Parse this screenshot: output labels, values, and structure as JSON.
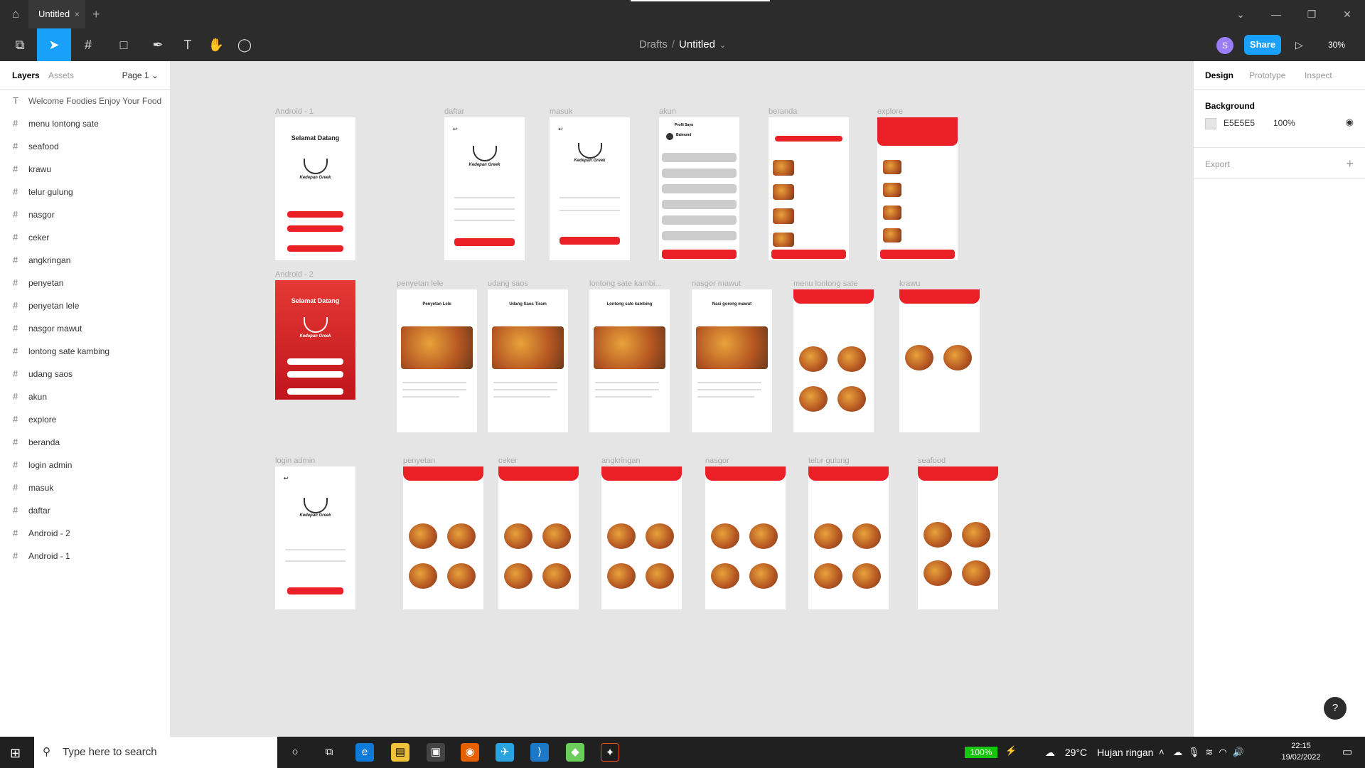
{
  "titlebar": {
    "tab_title": "Untitled",
    "close": "×",
    "new_tab": "+"
  },
  "toolbar": {
    "breadcrumb_drafts": "Drafts",
    "breadcrumb_sep": "/",
    "file_name": "Untitled",
    "avatar_letter": "S",
    "share_label": "Share",
    "zoom": "30%"
  },
  "left_panel": {
    "tab_layers": "Layers",
    "tab_assets": "Assets",
    "page_label": "Page 1",
    "layers": [
      {
        "label": "Welcome Foodies Enjoy Your Food",
        "type": "text"
      },
      {
        "label": "menu lontong sate",
        "type": "frame"
      },
      {
        "label": "seafood",
        "type": "frame"
      },
      {
        "label": "krawu",
        "type": "frame"
      },
      {
        "label": "telur gulung",
        "type": "frame"
      },
      {
        "label": "nasgor",
        "type": "frame"
      },
      {
        "label": "ceker",
        "type": "frame"
      },
      {
        "label": "angkringan",
        "type": "frame"
      },
      {
        "label": "penyetan",
        "type": "frame"
      },
      {
        "label": "penyetan lele",
        "type": "frame"
      },
      {
        "label": "nasgor mawut",
        "type": "frame"
      },
      {
        "label": "lontong sate kambing",
        "type": "frame"
      },
      {
        "label": "udang saos",
        "type": "frame"
      },
      {
        "label": "akun",
        "type": "frame"
      },
      {
        "label": "explore",
        "type": "frame"
      },
      {
        "label": "beranda",
        "type": "frame"
      },
      {
        "label": "login admin",
        "type": "frame"
      },
      {
        "label": "masuk",
        "type": "frame"
      },
      {
        "label": "daftar",
        "type": "frame"
      },
      {
        "label": "Android - 2",
        "type": "frame"
      },
      {
        "label": "Android - 1",
        "type": "frame"
      }
    ]
  },
  "right_panel": {
    "tab_design": "Design",
    "tab_prototype": "Prototype",
    "tab_inspect": "Inspect",
    "background_title": "Background",
    "background_hex": "E5E5E5",
    "background_opacity": "100%",
    "export_title": "Export"
  },
  "canvas": {
    "frames": {
      "android1": "Android - 1",
      "daftar": "daftar",
      "masuk": "masuk",
      "akun": "akun",
      "beranda": "beranda",
      "explore": "explore",
      "android2": "Android - 2",
      "penyetan_lele": "penyetan lele",
      "udang_saos": "udang saos",
      "lontong_sate": "lontong sate kambi...",
      "nasgor_mawut": "nasgor mawut",
      "menu_lontong_sate": "menu lontong sate",
      "krawu": "krawu",
      "login_admin": "login admin",
      "penyetan": "penyetan",
      "ceker": "ceker",
      "angkringan": "angkringan",
      "nasgor": "nasgor",
      "telur_gulung": "telur gulung",
      "seafood": "seafood"
    },
    "texts": {
      "selamat_datang": "Selamat Datang",
      "brand": "Kedepan Greek",
      "profil_saya": "Profil Saya",
      "user_name": "Balmond",
      "penyetan_lele_title": "Penyetan Lele",
      "udang_title": "Udang Saos Tiram",
      "lontong_title": "Lontong sate kambing",
      "nasgor_title": "Nasi goreng mawut"
    }
  },
  "taskbar": {
    "search_placeholder": "Type here to search",
    "battery": "100%",
    "temperature": "29°C",
    "weather": "Hujan ringan",
    "time": "22:15",
    "date": "19/02/2022"
  },
  "help": "?"
}
